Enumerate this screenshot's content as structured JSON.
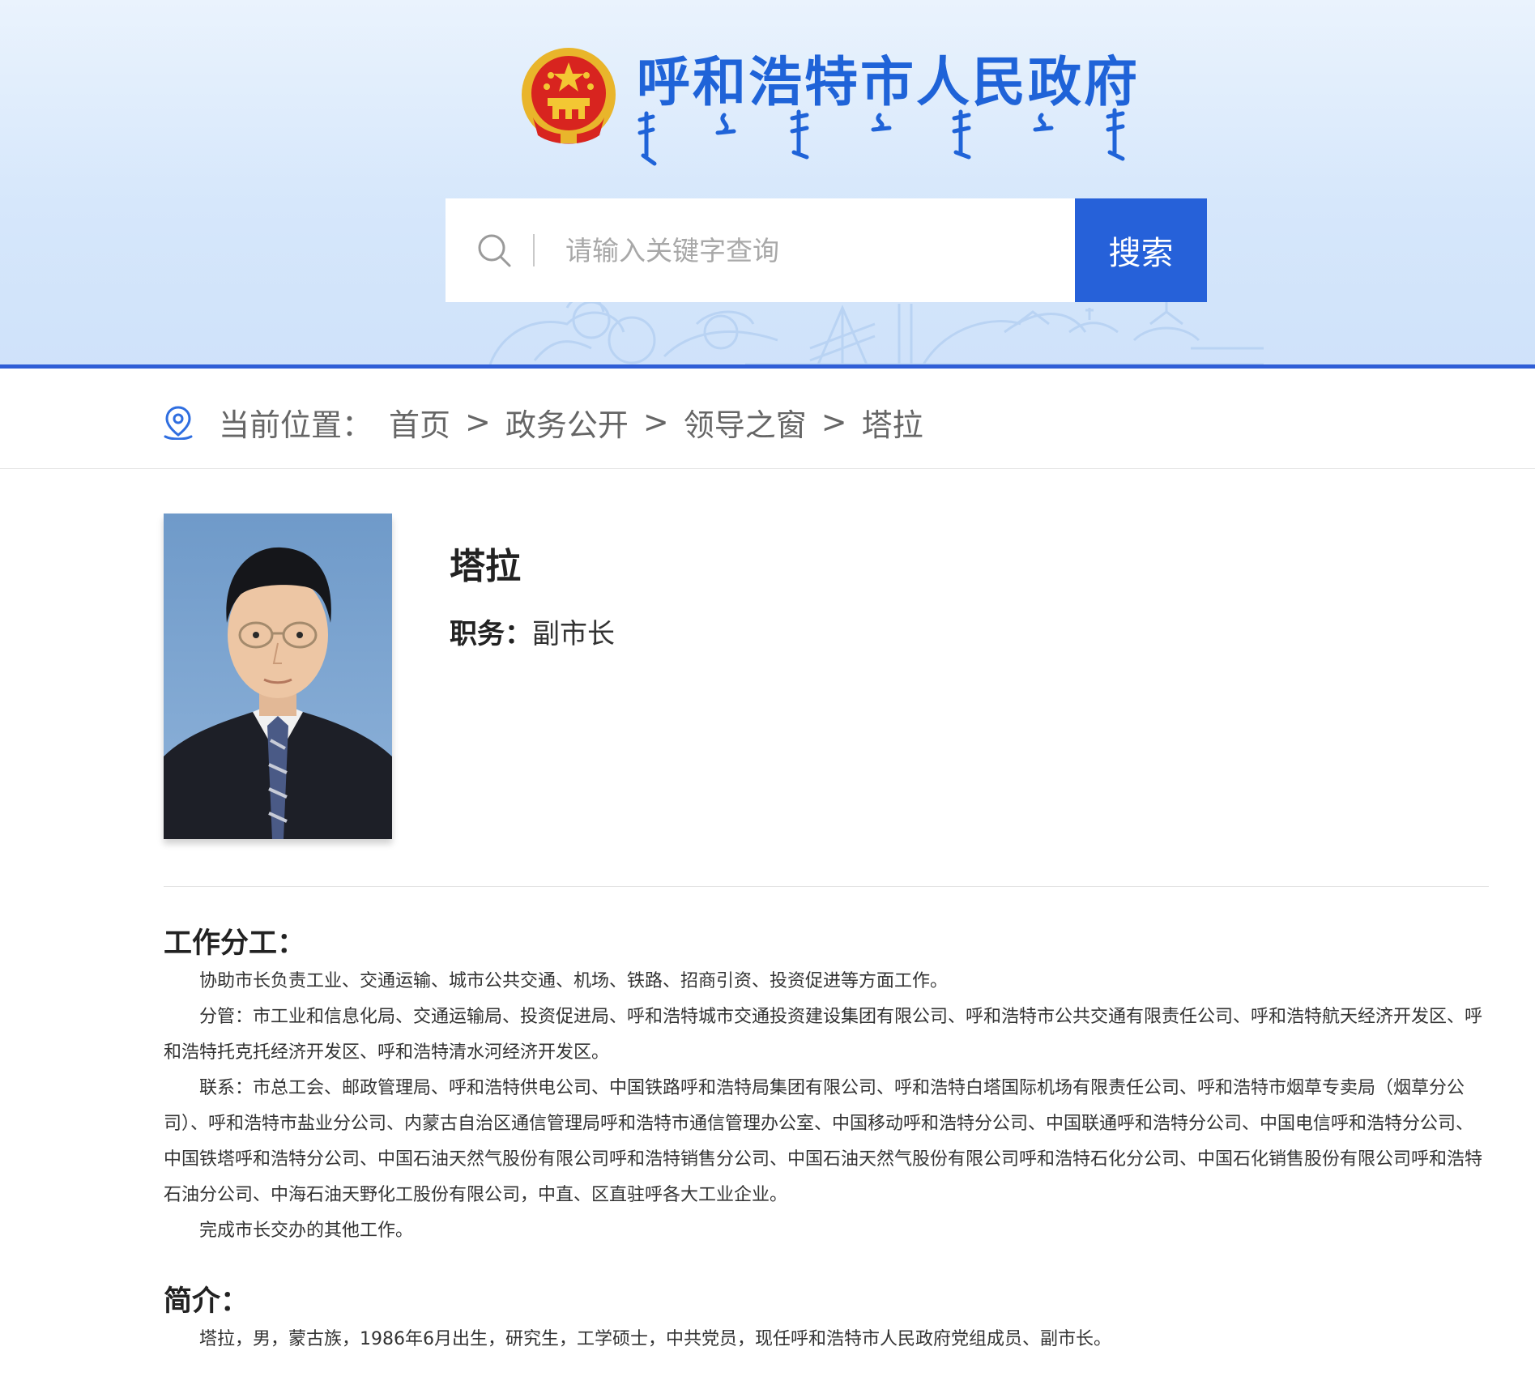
{
  "header": {
    "site_title": "呼和浩特市人民政府",
    "emblem_icon": "national-emblem-icon",
    "colors": {
      "title": "#1f63d8",
      "accent": "#2661d9",
      "bar": "#2f5ed6"
    }
  },
  "search": {
    "placeholder": "请输入关键字查询",
    "value": "",
    "button_label": "搜索",
    "icon": "search-icon"
  },
  "breadcrumb": {
    "icon": "location-pin-icon",
    "label": "当前位置：",
    "separator": ">",
    "items": [
      "首页",
      "政务公开",
      "领导之窗"
    ],
    "current": "塔拉"
  },
  "leader": {
    "name": "塔拉",
    "position_label": "职务：",
    "position_value": "副市长"
  },
  "duties": {
    "title": "工作分工：",
    "paragraphs": [
      "协助市长负责工业、交通运输、城市公共交通、机场、铁路、招商引资、投资促进等方面工作。",
      "分管：市工业和信息化局、交通运输局、投资促进局、呼和浩特城市交通投资建设集团有限公司、呼和浩特市公共交通有限责任公司、呼和浩特航天经济开发区、呼和浩特托克托经济开发区、呼和浩特清水河经济开发区。",
      "联系：市总工会、邮政管理局、呼和浩特供电公司、中国铁路呼和浩特局集团有限公司、呼和浩特白塔国际机场有限责任公司、呼和浩特市烟草专卖局（烟草分公司）、呼和浩特市盐业分公司、内蒙古自治区通信管理局呼和浩特市通信管理办公室、中国移动呼和浩特分公司、中国联通呼和浩特分公司、中国电信呼和浩特分公司、中国铁塔呼和浩特分公司、中国石油天然气股份有限公司呼和浩特销售分公司、中国石油天然气股份有限公司呼和浩特石化分公司、中国石化销售股份有限公司呼和浩特石油分公司、中海石油天野化工股份有限公司，中直、区直驻呼各大工业企业。",
      "完成市长交办的其他工作。"
    ]
  },
  "bio": {
    "title": "简介：",
    "paragraphs": [
      "塔拉，男，蒙古族，1986年6月出生，研究生，工学硕士，中共党员，现任呼和浩特市人民政府党组成员、副市长。"
    ]
  }
}
